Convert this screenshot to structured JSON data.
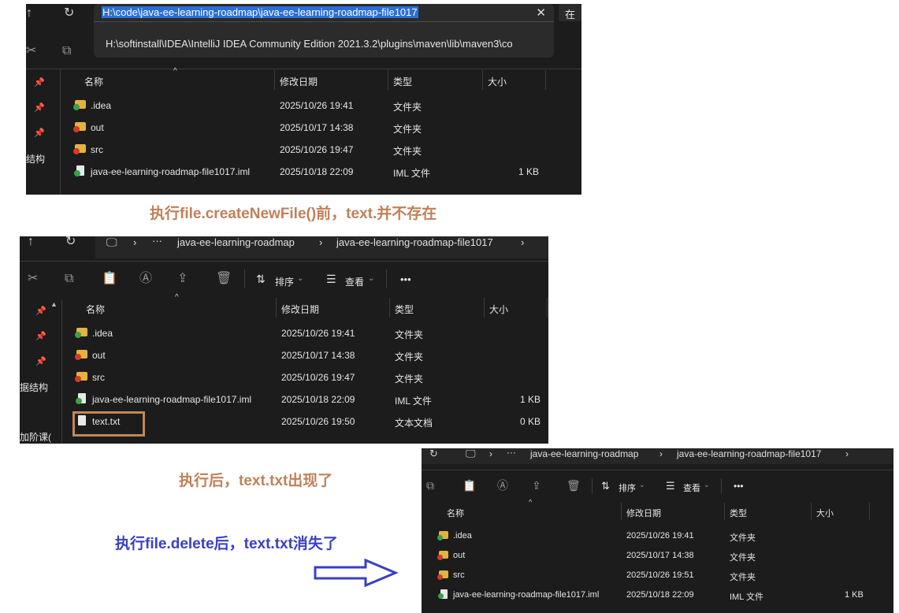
{
  "panel1": {
    "address_path": "H:\\code\\java-ee-learning-roadmap\\java-ee-learning-roadmap-file1017",
    "suggestion": "H:\\softinstall\\IDEA\\IntelliJ IDEA Community Edition 2021.3.2\\plugins\\maven\\lib\\maven3\\co",
    "partial_right": "在",
    "sidebar_label": "结构",
    "columns": {
      "name": "名称",
      "modified": "修改日期",
      "type": "类型",
      "size": "大小"
    },
    "files": [
      {
        "name": ".idea",
        "modified": "2025/10/26 19:41",
        "type": "文件夹",
        "size": ""
      },
      {
        "name": "out",
        "modified": "2025/10/17 14:38",
        "type": "文件夹",
        "size": ""
      },
      {
        "name": "src",
        "modified": "2025/10/26 19:47",
        "type": "文件夹",
        "size": ""
      },
      {
        "name": "java-ee-learning-roadmap-file1017.iml",
        "modified": "2025/10/18 22:09",
        "type": "IML 文件",
        "size": "1 KB"
      }
    ]
  },
  "caption1": "执行file.createNewFile()前，text.并不存在",
  "panel2": {
    "breadcrumb": [
      "java-ee-learning-roadmap",
      "java-ee-learning-roadmap-file1017"
    ],
    "sort_label": "排序",
    "view_label": "查看",
    "more_label": "•••",
    "sidebar_labels": [
      "据结构",
      "加阶课("
    ],
    "columns": {
      "name": "名称",
      "modified": "修改日期",
      "type": "类型",
      "size": "大小"
    },
    "files": [
      {
        "name": ".idea",
        "modified": "2025/10/26 19:41",
        "type": "文件夹",
        "size": ""
      },
      {
        "name": "out",
        "modified": "2025/10/17 14:38",
        "type": "文件夹",
        "size": ""
      },
      {
        "name": "src",
        "modified": "2025/10/26 19:47",
        "type": "文件夹",
        "size": ""
      },
      {
        "name": "java-ee-learning-roadmap-file1017.iml",
        "modified": "2025/10/18 22:09",
        "type": "IML 文件",
        "size": "1 KB"
      },
      {
        "name": "text.txt",
        "modified": "2025/10/26 19:50",
        "type": "文本文档",
        "size": "0 KB"
      }
    ],
    "highlight_color": "#c0875a"
  },
  "caption2": "执行后，text.txt出现了",
  "caption3": "执行file.delete后，text.txt消失了",
  "panel3": {
    "breadcrumb": [
      "java-ee-learning-roadmap",
      "java-ee-learning-roadmap-file1017"
    ],
    "sort_label": "排序",
    "view_label": "查看",
    "more_label": "•••",
    "columns": {
      "name": "名称",
      "modified": "修改日期",
      "type": "类型",
      "size": "大小"
    },
    "files": [
      {
        "name": ".idea",
        "modified": "2025/10/26 19:41",
        "type": "文件夹",
        "size": ""
      },
      {
        "name": "out",
        "modified": "2025/10/17 14:38",
        "type": "文件夹",
        "size": ""
      },
      {
        "name": "src",
        "modified": "2025/10/26 19:51",
        "type": "文件夹",
        "size": ""
      },
      {
        "name": "java-ee-learning-roadmap-file1017.iml",
        "modified": "2025/10/18 22:09",
        "type": "IML 文件",
        "size": "1 KB"
      }
    ]
  },
  "colors": {
    "caption_orange": "#c0805a",
    "caption_blue": "#3a3fc4",
    "arrow_blue": "#3a3fc4",
    "selection_blue": "#2a6fd6"
  }
}
